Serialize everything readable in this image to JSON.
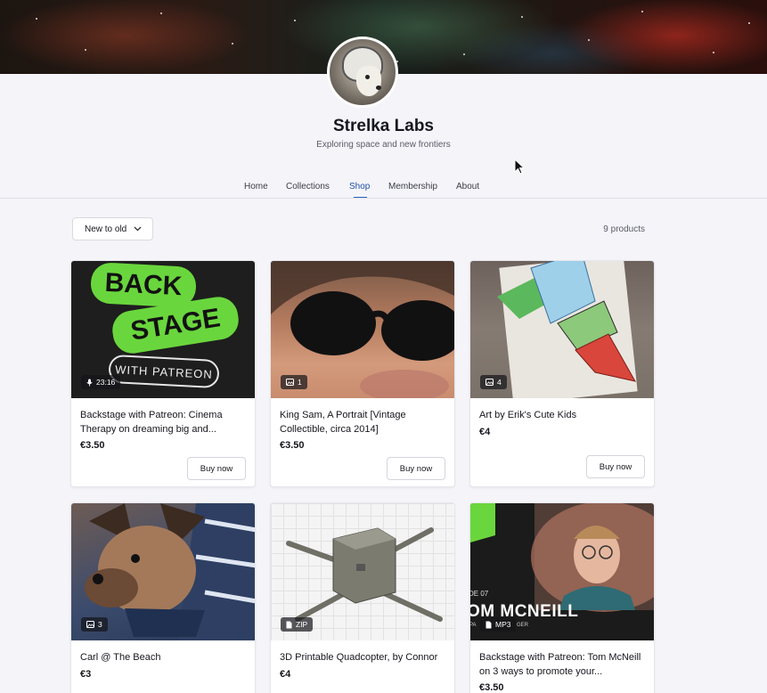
{
  "header": {
    "shop_name": "Strelka Labs",
    "tagline": "Exploring space and new frontiers"
  },
  "nav": {
    "tabs": [
      {
        "label": "Home",
        "active": false
      },
      {
        "label": "Collections",
        "active": false
      },
      {
        "label": "Shop",
        "active": true
      },
      {
        "label": "Membership",
        "active": false
      },
      {
        "label": "About",
        "active": false
      }
    ]
  },
  "toolbar": {
    "sort_label": "New to old",
    "product_count": "9 products"
  },
  "products": [
    {
      "title": "Backstage with Patreon: Cinema Therapy on dreaming big and...",
      "price": "€3.50",
      "buy_label": "Buy now",
      "badge_icon": "microphone-icon",
      "badge_text": "23:16",
      "thumb_text": {
        "line1": "BACK",
        "line2": "STAGE",
        "line3": "WITH PATREON"
      }
    },
    {
      "title": "King Sam, A Portrait [Vintage Collectible, circa 2014]",
      "price": "€3.50",
      "buy_label": "Buy now",
      "badge_icon": "image-icon",
      "badge_text": "1"
    },
    {
      "title": "Art by Erik's Cute Kids",
      "price": "€4",
      "buy_label": "Buy now",
      "badge_icon": "image-icon",
      "badge_text": "4"
    },
    {
      "title": "Carl @ The Beach",
      "price": "€3",
      "badge_icon": "image-icon",
      "badge_text": "3"
    },
    {
      "title": "3D Printable Quadcopter, by Connor",
      "price": "€4",
      "badge_icon": "file-icon",
      "badge_text": "ZIP"
    },
    {
      "title": "Backstage with Patreon: Tom McNeill on 3 ways to promote your...",
      "price": "€3.50",
      "badge_icon": "file-icon",
      "badge_text": "MP3",
      "thumb_text": {
        "name": "OM MCNEILL",
        "episode": "DE 07",
        "role": "PA",
        "role2": "GER"
      }
    }
  ],
  "colors": {
    "accent": "#1f53a5",
    "backstage_green": "#6ad63d"
  }
}
